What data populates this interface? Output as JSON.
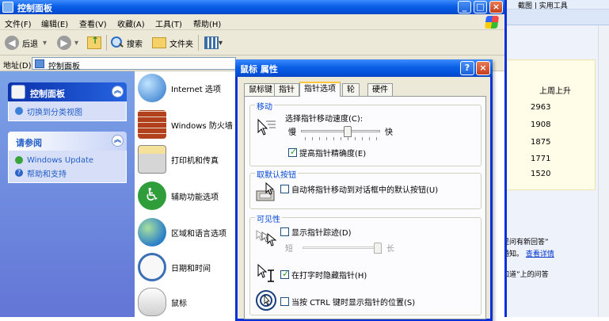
{
  "window": {
    "title": "控制面板",
    "buttons": {
      "minimize": "_",
      "maximize": "□",
      "close": "×"
    }
  },
  "menubar": [
    "文件(F)",
    "编辑(E)",
    "查看(V)",
    "收藏(A)",
    "工具(T)",
    "帮助(H)"
  ],
  "toolbar": {
    "back": "后退",
    "search": "搜索",
    "folders": "文件夹"
  },
  "address": {
    "label": "地址(D)",
    "value": "控制面板"
  },
  "taskpane": {
    "panel1": {
      "title": "控制面板",
      "link": "切换到分类视图"
    },
    "panel2": {
      "title": "请参阅",
      "links": [
        "Windows Update",
        "帮助和支持"
      ]
    }
  },
  "items": [
    "Internet 选项",
    "Windows 防火墙",
    "打印机和传真",
    "辅助功能选项",
    "区域和语言选项",
    "日期和时间",
    "鼠标"
  ],
  "dialog": {
    "title": "鼠标 属性",
    "help_button": "?",
    "close_button": "×",
    "tabs": [
      "鼠标键",
      "指针",
      "指针选项",
      "轮",
      "硬件"
    ],
    "active_tab": 2,
    "motion": {
      "group": "移动",
      "label": "选择指针移动速度(C):",
      "slow": "慢",
      "fast": "快",
      "speed_level": 0.6,
      "enhance_precision": {
        "label": "提高指针精确度(E)",
        "checked": true
      }
    },
    "snapto": {
      "group": "取默认按钮",
      "label": "自动将指针移动到对话框中的默认按钮(U)",
      "checked": false
    },
    "visibility": {
      "group": "可见性",
      "trails": {
        "label": "显示指针踪迹(D)",
        "checked": false
      },
      "short": "短",
      "long": "长",
      "trail_level": 1.0,
      "hide_typing": {
        "label": "在打字时隐藏指针(H)",
        "checked": true
      },
      "show_ctrl": {
        "label": "当按 CTRL 键时显示指针的位置(S)",
        "checked": false
      }
    }
  },
  "background_page": {
    "top_right": "截图   |  实用工具",
    "header": "上周上升",
    "values": [
      "2963",
      "1908",
      "1875",
      "1771",
      "1520"
    ],
    "note1": "提问有新回答”",
    "note2_prefix": "通知。",
    "note2_link": "查看详情",
    "note3": "知道”上的问答"
  }
}
